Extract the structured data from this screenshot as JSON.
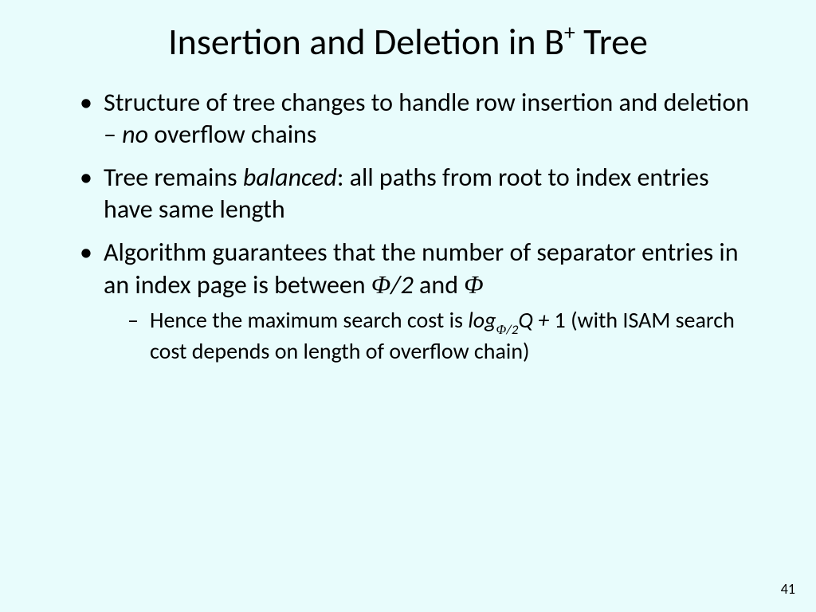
{
  "title": {
    "pre": "Insertion and Deletion in B",
    "sup": "+",
    "post": " Tree"
  },
  "bullets": {
    "b1_a": "Structure of tree changes to handle row insertion and deletion – ",
    "b1_no": "no",
    "b1_b": " overflow chains",
    "b2_a": "Tree remains ",
    "b2_bal": "balanced",
    "b2_b": ":  all paths from root to index entries have same length",
    "b3_a": "Algorithm guarantees that the number of separator entries in an index page is between ",
    "b3_phi1": "Φ",
    "b3_half": "/2",
    "b3_and": " and ",
    "b3_phi2": "Φ",
    "s1_a": "Hence the maximum search cost is ",
    "s1_log": "log",
    "s1_sub_phi": "Φ",
    "s1_sub_half": "/2",
    "s1_Q": "Q + ",
    "s1_one": "1 (with ISAM search cost depends on length of overflow chain)"
  },
  "page_number": "41"
}
